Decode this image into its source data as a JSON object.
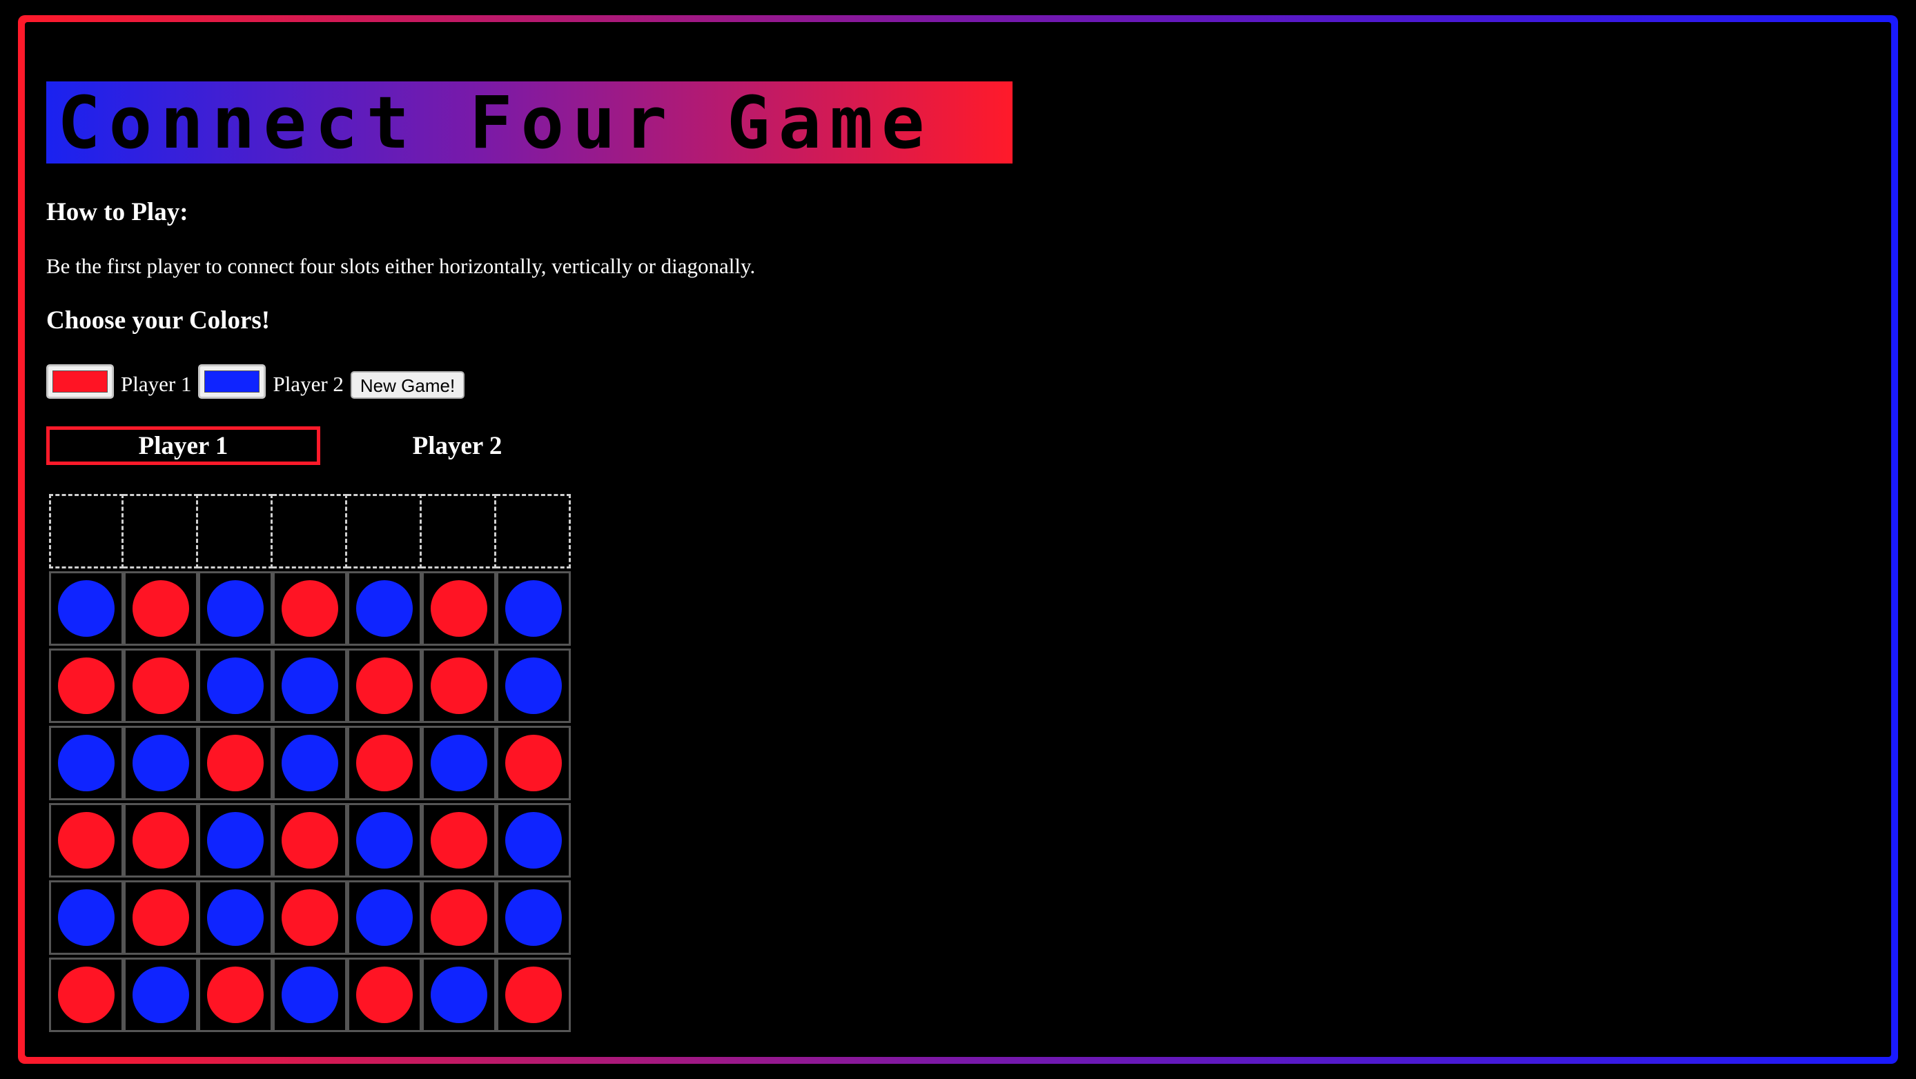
{
  "title": "Connect Four Game",
  "how_to_play": {
    "heading": "How to Play:",
    "text": "Be the first player to connect four slots either horizontally, vertically or diagonally."
  },
  "colors": {
    "heading": "Choose your Colors!",
    "player1_label": "Player 1",
    "player1_color": "#ff1424",
    "player2_label": "Player 2",
    "player2_color": "#0f24ff",
    "new_game_label": "New Game!"
  },
  "turn": {
    "player1": "Player 1",
    "player2": "Player 2",
    "active": "player1"
  },
  "theme": {
    "frame_gradient": [
      "#ff1a2a",
      "#1a1aff"
    ],
    "background": "#000000"
  },
  "board": {
    "columns": 7,
    "rows": [
      [
        "B",
        "R",
        "B",
        "R",
        "B",
        "R",
        "B"
      ],
      [
        "R",
        "R",
        "B",
        "B",
        "R",
        "R",
        "B"
      ],
      [
        "B",
        "B",
        "R",
        "B",
        "R",
        "B",
        "R"
      ],
      [
        "R",
        "R",
        "B",
        "R",
        "B",
        "R",
        "B"
      ],
      [
        "B",
        "R",
        "B",
        "R",
        "B",
        "R",
        "B"
      ],
      [
        "R",
        "B",
        "R",
        "B",
        "R",
        "B",
        "R"
      ]
    ]
  }
}
